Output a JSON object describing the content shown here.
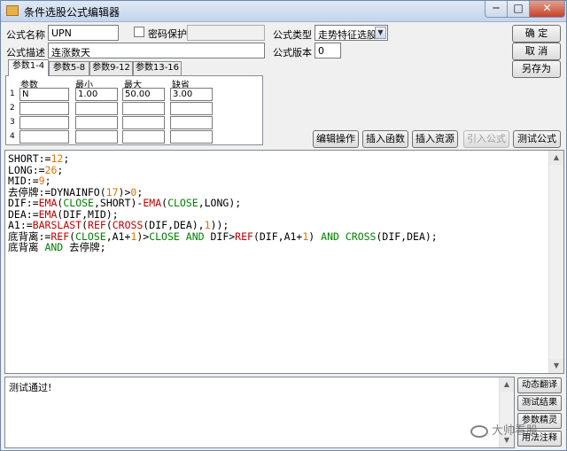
{
  "window": {
    "title": "条件选股公式编辑器"
  },
  "form": {
    "name_label": "公式名称",
    "name_value": "UPN",
    "password_label": "密码保护",
    "password_value": "",
    "desc_label": "公式描述",
    "desc_value": "连涨数天",
    "type_label": "公式类型",
    "type_value": "走势特征选股",
    "version_label": "公式版本",
    "version_value": "0"
  },
  "buttons": {
    "ok": "确  定",
    "cancel": "取  消",
    "save_as": "另存为",
    "edit_ops": "编辑操作",
    "insert_func": "插入函数",
    "insert_res": "插入资源",
    "import_formula": "引入公式",
    "test_formula": "测试公式"
  },
  "tabs": [
    "参数1-4",
    "参数5-8",
    "参数9-12",
    "参数13-16"
  ],
  "params": {
    "headers": [
      "参数",
      "最小",
      "最大",
      "缺省"
    ],
    "rows": [
      {
        "num": "1",
        "name": "N",
        "min": "1.00",
        "max": "50.00",
        "def": "3.00"
      },
      {
        "num": "2",
        "name": "",
        "min": "",
        "max": "",
        "def": ""
      },
      {
        "num": "3",
        "name": "",
        "min": "",
        "max": "",
        "def": ""
      },
      {
        "num": "4",
        "name": "",
        "min": "",
        "max": "",
        "def": ""
      }
    ]
  },
  "colors": {
    "number": "#e07000",
    "function": "#c00000",
    "keyword": "#008000",
    "text": "#000000"
  },
  "code": [
    [
      {
        "t": "SHORT:="
      },
      {
        "t": "12",
        "c": "number"
      },
      {
        "t": ";"
      }
    ],
    [
      {
        "t": "LONG:="
      },
      {
        "t": "26",
        "c": "number"
      },
      {
        "t": ";"
      }
    ],
    [
      {
        "t": "MID:="
      },
      {
        "t": "9",
        "c": "number"
      },
      {
        "t": ";"
      }
    ],
    [
      {
        "t": "去停牌:=DYNAINFO("
      },
      {
        "t": "17",
        "c": "number"
      },
      {
        "t": ")>"
      },
      {
        "t": "0",
        "c": "number"
      },
      {
        "t": ";"
      }
    ],
    [
      {
        "t": "DIF:="
      },
      {
        "t": "EMA",
        "c": "function"
      },
      {
        "t": "("
      },
      {
        "t": "CLOSE",
        "c": "keyword"
      },
      {
        "t": ",SHORT)-"
      },
      {
        "t": "EMA",
        "c": "function"
      },
      {
        "t": "("
      },
      {
        "t": "CLOSE",
        "c": "keyword"
      },
      {
        "t": ",LONG);"
      }
    ],
    [
      {
        "t": "DEA:="
      },
      {
        "t": "EMA",
        "c": "function"
      },
      {
        "t": "(DIF,MID);"
      }
    ],
    [
      {
        "t": "A1:="
      },
      {
        "t": "BARSLAST",
        "c": "function"
      },
      {
        "t": "("
      },
      {
        "t": "REF",
        "c": "function"
      },
      {
        "t": "("
      },
      {
        "t": "CROSS",
        "c": "function"
      },
      {
        "t": "(DIF,DEA),"
      },
      {
        "t": "1",
        "c": "number"
      },
      {
        "t": "));"
      }
    ],
    [
      {
        "t": "底背离:="
      },
      {
        "t": "REF",
        "c": "function"
      },
      {
        "t": "("
      },
      {
        "t": "CLOSE",
        "c": "keyword"
      },
      {
        "t": ",A1+"
      },
      {
        "t": "1",
        "c": "number"
      },
      {
        "t": ")>"
      },
      {
        "t": "CLOSE",
        "c": "keyword"
      },
      {
        "t": " "
      },
      {
        "t": "AND",
        "c": "keyword"
      },
      {
        "t": " DIF>"
      },
      {
        "t": "REF",
        "c": "function"
      },
      {
        "t": "(DIF,A1+"
      },
      {
        "t": "1",
        "c": "number"
      },
      {
        "t": ") "
      },
      {
        "t": "AND",
        "c": "keyword"
      },
      {
        "t": " "
      },
      {
        "t": "CROSS",
        "c": "keyword"
      },
      {
        "t": "(DIF,DEA);"
      }
    ],
    [
      {
        "t": "底背离 "
      },
      {
        "t": "AND",
        "c": "keyword"
      },
      {
        "t": " 去停牌;"
      }
    ]
  ],
  "output": {
    "text": "测试通过!"
  },
  "side_buttons": [
    "动态翻译",
    "测试结果",
    "参数精灵",
    "用法注释"
  ],
  "watermark": "大帅看股"
}
